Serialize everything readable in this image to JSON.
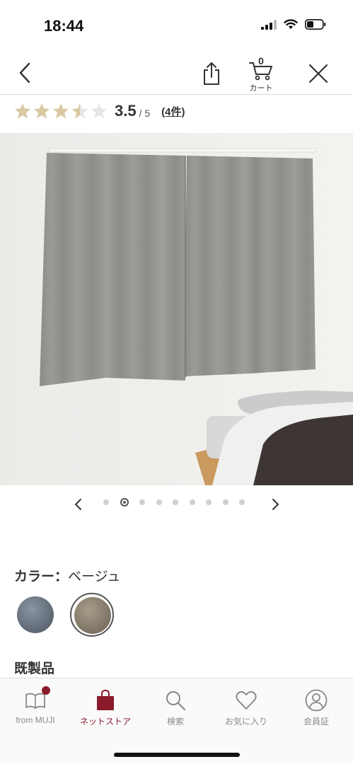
{
  "status_bar": {
    "time": "18:44",
    "icons": [
      "signal-icon",
      "wifi-icon",
      "battery-icon"
    ]
  },
  "nav": {
    "back_icon": "chevron-left-icon",
    "share_icon": "share-icon",
    "cart_icon": "cart-icon",
    "cart_count": "0",
    "cart_label": "カート",
    "close_icon": "close-icon"
  },
  "rating": {
    "stars_filled": 3.5,
    "stars_total": 5,
    "value": "3.5",
    "max": "/ 5",
    "review_count": "(4件)",
    "star_color": "#d9c9a3"
  },
  "carousel": {
    "total": 9,
    "active_index": 1
  },
  "color_section": {
    "label_prefix": "カラー：",
    "label_value": "ベージュ",
    "swatches": [
      {
        "name": "gray",
        "color": "#6f7a86",
        "selected": false
      },
      {
        "name": "beige",
        "color": "#8f8676",
        "selected": true
      }
    ]
  },
  "section_title": "既製品",
  "tab_bar": {
    "accent_color": "#8b1a2b",
    "tabs": [
      {
        "label": "from MUJI",
        "icon": "book-icon",
        "active": false,
        "badge": true
      },
      {
        "label": "ネットストア",
        "icon": "shopping-bag-icon",
        "active": true,
        "badge": false
      },
      {
        "label": "検索",
        "icon": "search-icon",
        "active": false,
        "badge": false
      },
      {
        "label": "お気に入り",
        "icon": "heart-icon",
        "active": false,
        "badge": false
      },
      {
        "label": "会員証",
        "icon": "user-icon",
        "active": false,
        "badge": false
      }
    ]
  }
}
